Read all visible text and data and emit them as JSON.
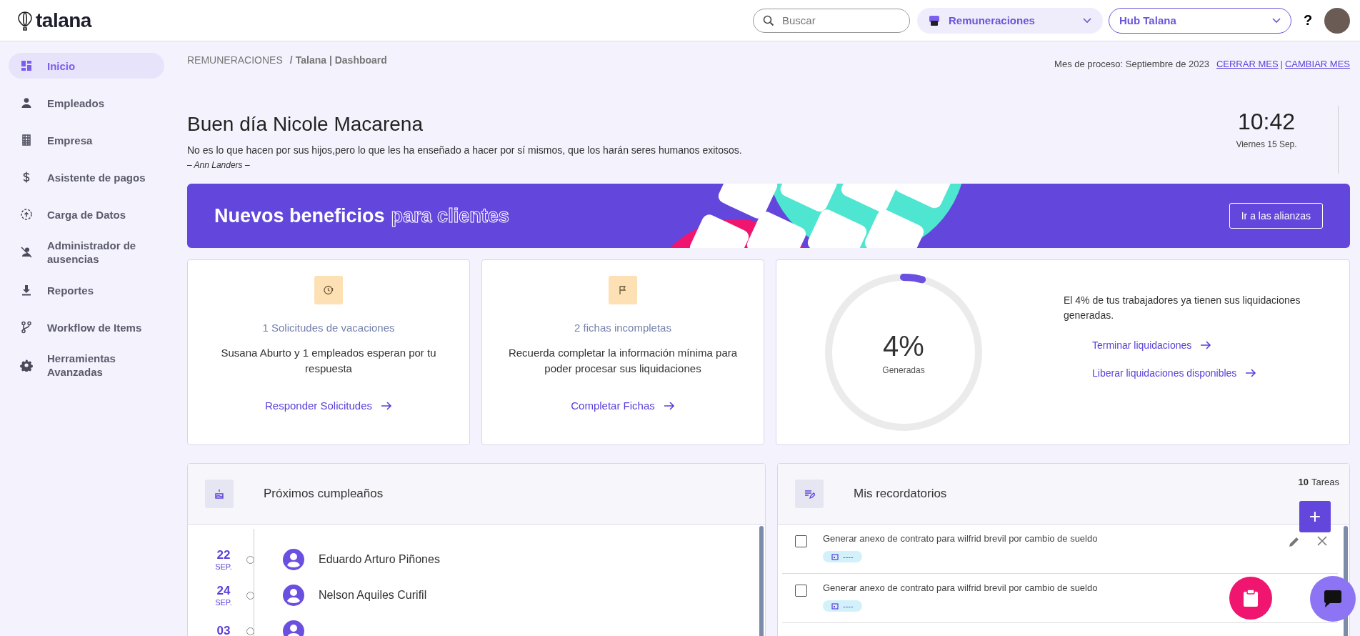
{
  "header": {
    "logo": "talana",
    "search": {
      "placeholder": "Buscar"
    },
    "module": "Remuneraciones",
    "hub": "Hub Talana",
    "help": "?"
  },
  "sidebar": {
    "items": [
      {
        "label": "Inicio",
        "selected": true
      },
      {
        "label": "Empleados",
        "selected": false
      },
      {
        "label": "Empresa",
        "selected": false
      },
      {
        "label": "Asistente de pagos",
        "selected": false
      },
      {
        "label": "Carga de Datos",
        "selected": false
      },
      {
        "label": "Administrador de ausencias",
        "selected": false
      },
      {
        "label": "Reportes",
        "selected": false
      },
      {
        "label": "Workflow de Items",
        "selected": false
      },
      {
        "label": "Herramientas Avanzadas",
        "selected": false
      }
    ]
  },
  "breadcrumb": {
    "section": "REMUNERACIONES",
    "separator": "/",
    "page": "Talana | Dashboard"
  },
  "process": {
    "label": "Mes de proceso: Septiembre de 2023",
    "close": "CERRAR MES",
    "separator": "|",
    "change": "CAMBIAR MES"
  },
  "greeting": {
    "title": "Buen día Nicole Macarena",
    "quote": "No es lo que hacen por sus hijos,pero lo que les ha enseñado a hacer por sí mismos, que los harán seres humanos exitosos.",
    "author": "– Ann Landers –",
    "time": "10:42",
    "date": "Viernes 15 Sep."
  },
  "banner": {
    "title": "Nuevos beneficios",
    "title_outline": "para clientes",
    "button": "Ir a las alianzas"
  },
  "cards": [
    {
      "title": "1 Solicitudes de vacaciones",
      "text": "Susana Aburto y 1 empleados esperan por tu respuesta",
      "link": "Responder Solicitudes"
    },
    {
      "title": "2 fichas incompletas",
      "text": "Recuerda completar la información mínima para poder procesar sus liquidaciones",
      "link": "Completar Fichas"
    }
  ],
  "progress": {
    "level": 0.04,
    "value": "4%",
    "caption": "Generadas",
    "text": "El 4% de tus trabajadores ya tienen sus liquidaciones generadas.",
    "links": [
      "Terminar liquidaciones",
      "Liberar liquidaciones disponibles"
    ]
  },
  "birthdays": {
    "title": "Próximos cumpleaños",
    "rows": [
      {
        "day": "22",
        "month": "SEP.",
        "name": "Eduardo Arturo Piñones"
      },
      {
        "day": "24",
        "month": "SEP.",
        "name": "Nelson Aquiles Curifil"
      },
      {
        "day": "03"
      }
    ]
  },
  "reminders": {
    "title": "Mis recordatorios",
    "count": "10",
    "count_label": "Tareas",
    "add": "+",
    "items": [
      {
        "text": "Generar anexo de contrato para wilfrid brevil por cambio de sueldo",
        "date": "----",
        "checked": false,
        "actions": true
      },
      {
        "text": "Generar anexo de contrato para wilfrid brevil por cambio de sueldo",
        "date": "----",
        "checked": false,
        "actions": false
      }
    ]
  }
}
